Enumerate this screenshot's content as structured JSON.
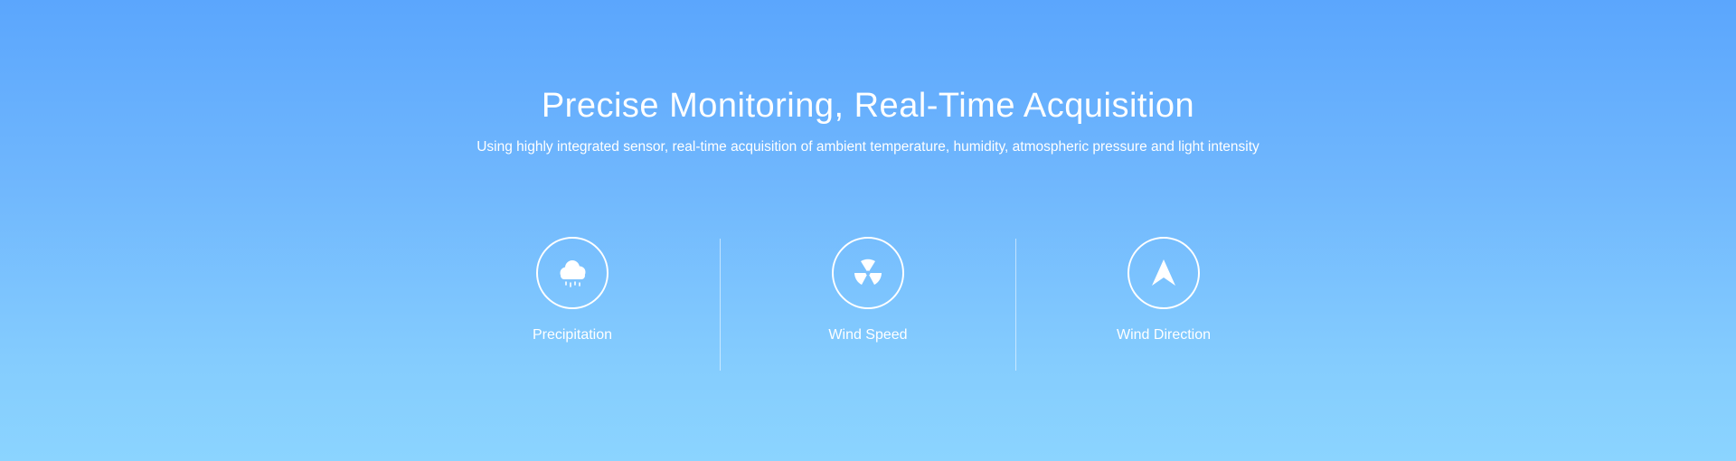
{
  "hero": {
    "title": "Precise Monitoring, Real-Time Acquisition",
    "subtitle": "Using highly integrated sensor, real-time acquisition of ambient temperature, humidity, atmospheric pressure and light intensity"
  },
  "features": [
    {
      "label": "Precipitation",
      "icon": "rain-cloud-icon"
    },
    {
      "label": "Wind Speed",
      "icon": "fan-icon"
    },
    {
      "label": "Wind Direction",
      "icon": "navigation-arrow-icon"
    }
  ],
  "colors": {
    "gradient_top": "#5ba6fd",
    "gradient_bottom": "#8bd4ff",
    "text": "#ffffff"
  }
}
